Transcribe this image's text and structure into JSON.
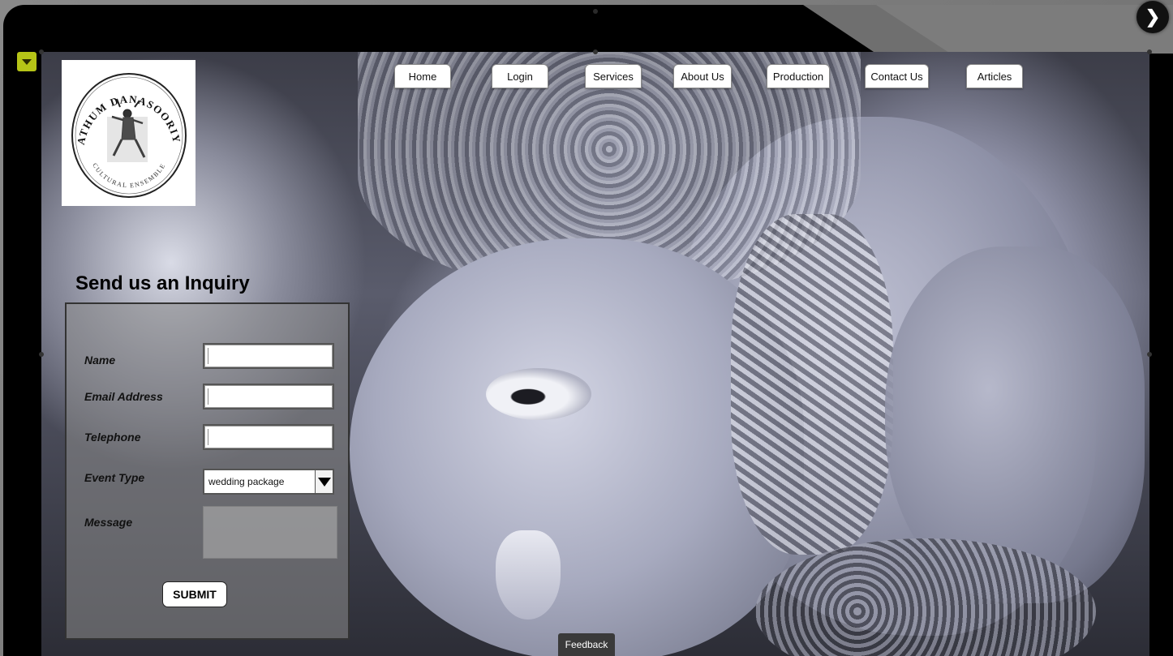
{
  "site": {
    "logo": {
      "top_text": "PATHUM DANASOORIYA",
      "bottom_text": "CULTURAL ENSEMBLE"
    },
    "nav": [
      {
        "label": "Home"
      },
      {
        "label": "Login"
      },
      {
        "label": "Services"
      },
      {
        "label": "About Us"
      },
      {
        "label": "Production"
      },
      {
        "label": "Contact Us"
      },
      {
        "label": "Articles"
      }
    ]
  },
  "inquiry_form": {
    "title": "Send us an Inquiry",
    "fields": {
      "name_label": "Name",
      "email_label": "Email Address",
      "telephone_label": "Telephone",
      "event_type_label": "Event Type",
      "event_type_value": "wedding package",
      "message_label": "Message",
      "name_value": "",
      "email_value": "",
      "telephone_value": ""
    },
    "submit_label": "SUBMIT"
  },
  "viewer": {
    "feedback_label": "Feedback",
    "next_icon": "chevron-right-icon",
    "toggle_icon": "caret-down-icon",
    "toggle_color": "#b6c417"
  }
}
